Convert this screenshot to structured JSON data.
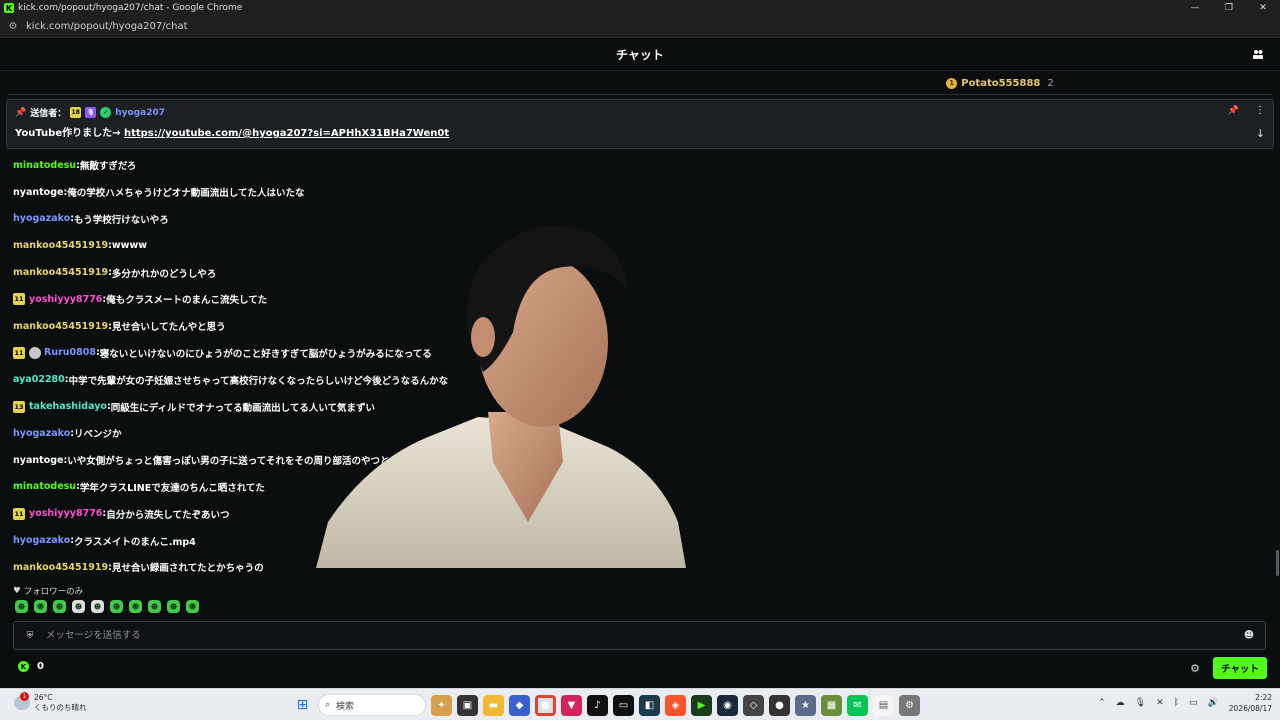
{
  "browser": {
    "window_title": "kick.com/popout/hyoga207/chat - Google Chrome",
    "favicon_letter": "K",
    "url": "kick.com/popout/hyoga207/chat"
  },
  "header": {
    "title": "チャット"
  },
  "gifter": {
    "name": "Potato555888",
    "count": "2"
  },
  "pinned": {
    "prefix": "送信者：",
    "badge_number": "18",
    "author": "hyoga207",
    "message_text": "YouTube作りました→ ",
    "message_link": "https://youtube.com/@hyoga207?si=APHhX31BHa7Wen0t"
  },
  "messages": [
    {
      "user": "minatodesu",
      "color": "#53fc18",
      "text": "無敵すぎだろ"
    },
    {
      "user": "nyantoge",
      "color": "#ffffff",
      "text": "俺の学校ハメちゃうけどオナ動画流出してた人はいたな"
    },
    {
      "user": "hyogazako",
      "color": "#7a95ff",
      "text": "もう学校行けないやろ"
    },
    {
      "user": "mankoo45451919",
      "color": "#e8d26c",
      "text": "wwww"
    },
    {
      "user": "mankoo45451919",
      "color": "#e8d26c",
      "text": "多分かれかのどうしやろ"
    },
    {
      "user": "yoshiyyy8776",
      "color": "#ff4fd1",
      "text": "俺もクラスメートのまんこ流失してた",
      "badge": "11"
    },
    {
      "user": "mankoo45451919",
      "color": "#e8d26c",
      "text": "見せ合いしてたんやと思う"
    },
    {
      "user": "Ruru0808",
      "color": "#7a95ff",
      "text": "寝ないといけないのにひょうがのこと好きすぎて脳がひょうがみるになってる",
      "badge": "11",
      "avatar": true
    },
    {
      "user": "aya02280",
      "color": "#53e8c8",
      "text": "中学で先輩が女の子妊娠させちゃって高校行けなくなったらしいけど今後どうなるんかな"
    },
    {
      "user": "takehashidayo",
      "color": "#53e8c8",
      "text": "同級生にディルドでオナってる動画流出してる人いて気まずい",
      "badge": "13"
    },
    {
      "user": "hyogazako",
      "color": "#7a95ff",
      "text": "リベンジか"
    },
    {
      "user": "nyantoge",
      "color": "#ffffff",
      "text": "いや女側がちょっと傷害っぽい男の子に送ってそれをその周り部活のやつとかに三百円とか"
    },
    {
      "user": "minatodesu",
      "color": "#53fc18",
      "text": "学年クラスLINEで友達のちんこ晒されてた"
    },
    {
      "user": "yoshiyyy8776",
      "color": "#ff4fd1",
      "text": "自分から流失してたぞあいつ",
      "badge": "11"
    },
    {
      "user": "hyogazako",
      "color": "#7a95ff",
      "text": "クラスメイトのまんこ.mp4"
    },
    {
      "user": "mankoo45451919",
      "color": "#e8d26c",
      "text": "見せ合い録画されてたとかちゃうの"
    }
  ],
  "followers_only": {
    "label": "フォロワーのみ"
  },
  "input": {
    "placeholder": "メッセージを送信する"
  },
  "points": {
    "value": "0"
  },
  "send_button": {
    "label": "チャット"
  },
  "taskbar": {
    "weather_temp": "26°C",
    "weather_desc": "くもりのち晴れ",
    "weather_badge": "1",
    "search_placeholder": "検索",
    "time": "2:22",
    "date": "2026/08/17"
  }
}
